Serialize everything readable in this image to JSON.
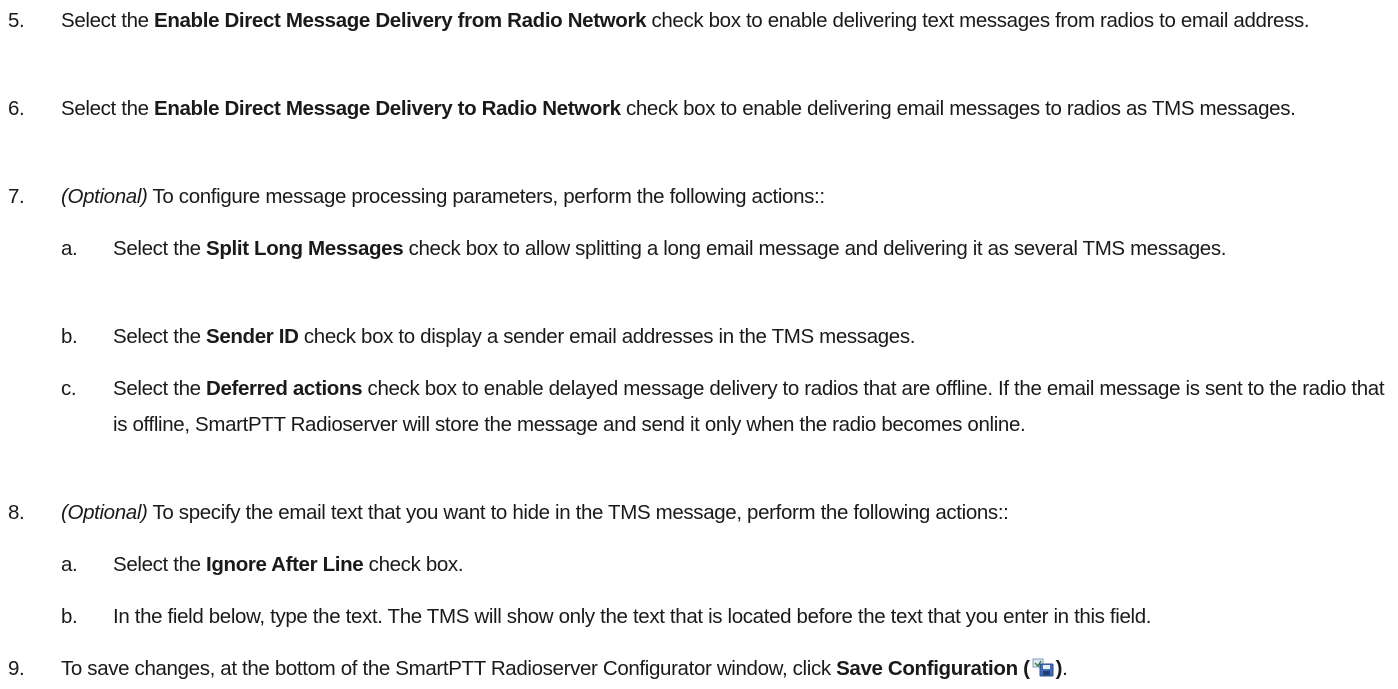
{
  "steps": [
    {
      "num": "5.",
      "pre": "Select the ",
      "bold": "Enable Direct Message Delivery from Radio Network",
      "post": " check box to enable delivering text messages from radios to email address."
    },
    {
      "num": "6.",
      "pre": "Select the ",
      "bold": "Enable Direct Message Delivery to Radio Network",
      "post": " check box to enable delivering email messages to radios as TMS messages."
    },
    {
      "num": "7.",
      "italic": "(Optional)",
      "post": " To configure message processing parameters, perform the following actions::",
      "substeps": [
        {
          "num": "a.",
          "pre": "Select the ",
          "bold": "Split Long Messages",
          "post": " check box to allow splitting a long email message and delivering it as several TMS messages."
        },
        {
          "num": "b.",
          "pre": "Select the ",
          "bold": "Sender ID",
          "post": " check box to display a sender email addresses in the TMS messages."
        },
        {
          "num": "c.",
          "pre": "Select the ",
          "bold": "Deferred actions",
          "post": " check box to enable delayed message delivery to radios that are offline. If the email message is sent to the radio that is offline, SmartPTT Radioserver will store the message and send it only when the radio becomes online."
        }
      ]
    },
    {
      "num": "8.",
      "italic": "(Optional)",
      "post": " To specify the email text that you want to hide in the TMS message, perform the following actions::",
      "substeps": [
        {
          "num": "a.",
          "pre": "Select the ",
          "bold": "Ignore After Line",
          "post": " check box."
        },
        {
          "num": "b.",
          "text": "In the field below, type the text. The TMS will show only the text that is located before the text that you enter in this field."
        }
      ]
    },
    {
      "num": "9.",
      "pre": "To save changes, at the bottom of the SmartPTT Radioserver Configurator window, click ",
      "bold": "Save Configuration (",
      "icon": "save-configuration-icon",
      "bold_close": ")",
      "post": "."
    }
  ]
}
